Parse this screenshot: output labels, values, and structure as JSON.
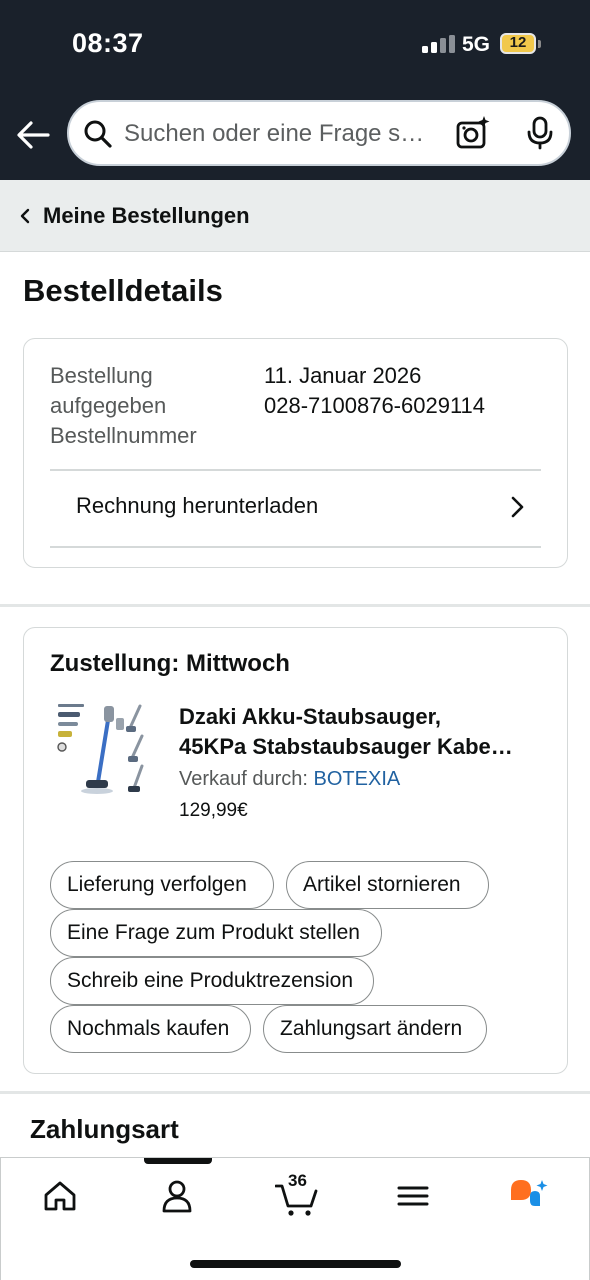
{
  "status_bar": {
    "time": "08:37",
    "network": "5G",
    "battery": "12"
  },
  "search": {
    "placeholder": "Suchen oder eine Frage s…",
    "icons": [
      "back-arrow-icon",
      "search-icon",
      "camera-sparkle-icon",
      "microphone-icon"
    ]
  },
  "breadcrumb": {
    "label": "Meine Bestellungen"
  },
  "page": {
    "title": "Bestelldetails"
  },
  "order": {
    "labels": [
      "Bestellung",
      "aufgegeben",
      "Bestellnummer"
    ],
    "date": "11. Januar 2026",
    "number": "028-7100876-6029114",
    "invoice_label": "Rechnung herunterladen"
  },
  "delivery": {
    "title": "Zustellung: Mittwoch",
    "product": {
      "name_line1": "Dzaki Akku-Staubsauger,",
      "name_line2": "45KPa Stabstaubsauger Kabe…",
      "sold_by_prefix": "Verkauf durch:",
      "seller": "BOTEXIA",
      "price": "129,99€"
    },
    "actions": [
      "Lieferung verfolgen",
      "Artikel stornieren",
      "Eine Frage zum Produkt stellen",
      "Schreib eine Produktrezension",
      "Nochmals kaufen",
      "Zahlungsart ändern"
    ]
  },
  "payment": {
    "title": "Zahlungsart"
  },
  "bottom_nav": {
    "items": [
      "home-icon",
      "profile-icon",
      "cart-icon",
      "menu-icon",
      "rufus-assistant-icon"
    ],
    "cart_count": "36"
  },
  "colors": {
    "header_bg": "#1a212b",
    "link": "#2162a1",
    "battery": "#f1c84b",
    "assistant_orange": "#ff6f1f",
    "assistant_blue": "#1a8fe6"
  }
}
